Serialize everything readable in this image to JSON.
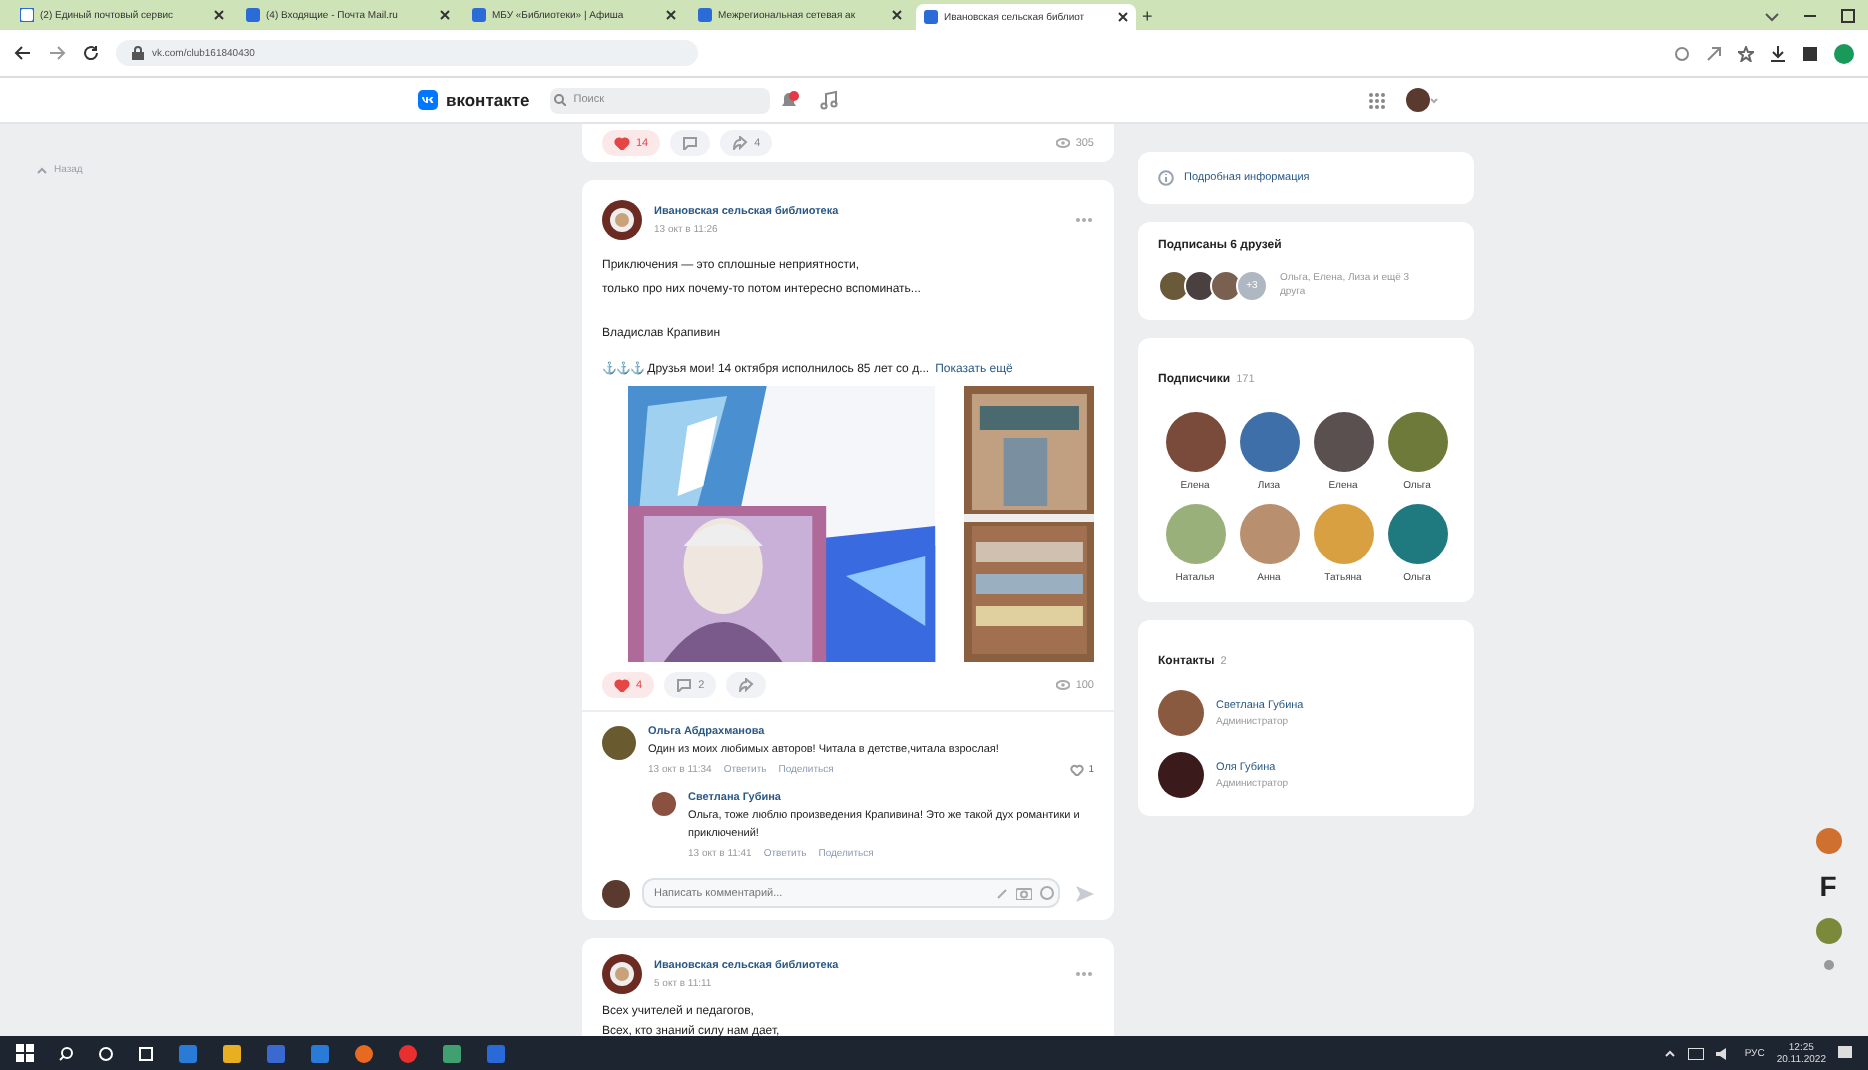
{
  "browser": {
    "tabs": [
      {
        "title": "(2) Единый почтовый сервис",
        "selected": false
      },
      {
        "title": "(4) Входящие - Почта Mail.ru",
        "selected": false
      },
      {
        "title": "МБУ «Библиотеки» | Афиша",
        "selected": false
      },
      {
        "title": "Межрегиональная сетевая ак",
        "selected": false
      },
      {
        "title": "Ивановская сельская библиот",
        "selected": true
      }
    ],
    "new_tab": "+",
    "address": "vk.com/club161840430"
  },
  "header": {
    "logo": "вконтакте",
    "search": {
      "placeholder": "Поиск"
    }
  },
  "back": "Назад",
  "partial_post": {
    "likes": "14",
    "liked": true,
    "shares": "4",
    "views": "305"
  },
  "post": {
    "author": "Ивановская сельская библиотека",
    "date": "13 окт в 11:26",
    "paragraphs": [
      [
        "Приключения — это сплошные неприятности,",
        "только про них почему-то потом интересно вспоминать..."
      ],
      [
        "Владислав Крапивин"
      ]
    ],
    "teaser": "⚓⚓⚓ Друзья мои! 14 октября исполнилось 85 лет со д...",
    "more": "Показать ещё",
    "likes": "4",
    "liked": true,
    "comments": "2",
    "views": "100",
    "comment_list": [
      {
        "author": "Ольга Абдрахманова",
        "text": "Один из моих любимых авторов! Читала в детстве,читала взрослая!",
        "date": "13 окт в 11:34",
        "actions": [
          "Ответить",
          "Поделиться"
        ],
        "likes": "1",
        "replies": [
          {
            "author": "Светлана Губина",
            "text": "Ольга, тоже люблю произведения Крапивина! Это же такой дух романтики и приключений!",
            "date": "13 окт в 11:41",
            "actions": [
              "Ответить",
              "Поделиться"
            ]
          }
        ]
      }
    ],
    "comment_placeholder": "Написать комментарий..."
  },
  "next_post": {
    "author": "Ивановская сельская библиотека",
    "date": "5 окт в 11:11",
    "text": [
      "Всех учителей и педагогов,",
      "Всех, кто знаний силу нам дает,"
    ]
  },
  "sidebar": {
    "info_link": "Подробная информация",
    "friends": {
      "title": "Подписаны 6 друзей",
      "more": "+3",
      "names": "Ольга, Елена, Лиза и ещё 3 друга"
    },
    "followers": {
      "title": "Подписчики",
      "count": "171",
      "people": [
        {
          "name": "Елена",
          "color": "#7a4a3a"
        },
        {
          "name": "Лиза",
          "color": "#3f6fa8"
        },
        {
          "name": "Елена",
          "color": "#5a5050"
        },
        {
          "name": "Ольга",
          "color": "#6d7a3a"
        },
        {
          "name": "Наталья",
          "color": "#9ab07a"
        },
        {
          "name": "Анна",
          "color": "#b89070"
        },
        {
          "name": "Татьяна",
          "color": "#d8a040"
        },
        {
          "name": "Ольга",
          "color": "#1f7a80"
        }
      ]
    },
    "contacts": {
      "title": "Контакты",
      "count": "2",
      "items": [
        {
          "name": "Светлана Губина",
          "role": "Администратор"
        },
        {
          "name": "Оля Губина",
          "role": "Администратор"
        }
      ]
    }
  },
  "side_widget": "F",
  "taskbar": {
    "lang": "РУС",
    "time": "12:25",
    "date": "20.11.2022"
  }
}
